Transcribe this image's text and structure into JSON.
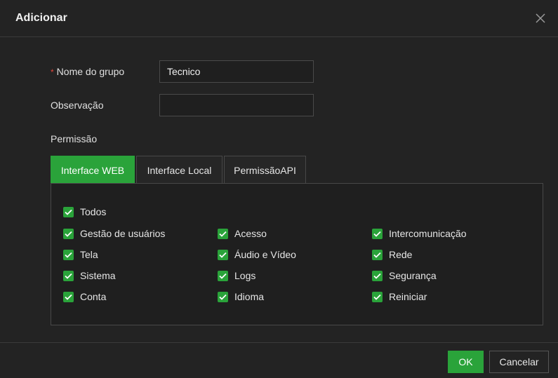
{
  "dialog": {
    "title": "Adicionar",
    "close_icon": "close-icon"
  },
  "form": {
    "group_name": {
      "label": "Nome do grupo",
      "required_mark": "*",
      "value": "Tecnico",
      "placeholder": ""
    },
    "observation": {
      "label": "Observação",
      "value": "",
      "placeholder": ""
    },
    "permission_label": "Permissão"
  },
  "tabs": [
    {
      "label": "Interface WEB",
      "active": true
    },
    {
      "label": "Interface Local",
      "active": false
    },
    {
      "label": "PermissãoAPI",
      "active": false
    }
  ],
  "permissions": {
    "all": {
      "label": "Todos",
      "checked": true
    },
    "items": [
      {
        "label": "Gestão de usuários",
        "checked": true
      },
      {
        "label": "Acesso",
        "checked": true
      },
      {
        "label": "Intercomunicação",
        "checked": true
      },
      {
        "label": "Tela",
        "checked": true
      },
      {
        "label": "Áudio e Vídeo",
        "checked": true
      },
      {
        "label": "Rede",
        "checked": true
      },
      {
        "label": "Sistema",
        "checked": true
      },
      {
        "label": "Logs",
        "checked": true
      },
      {
        "label": "Segurança",
        "checked": true
      },
      {
        "label": "Conta",
        "checked": true
      },
      {
        "label": "Idioma",
        "checked": true
      },
      {
        "label": "Reiniciar",
        "checked": true
      }
    ]
  },
  "footer": {
    "ok_label": "OK",
    "cancel_label": "Cancelar"
  },
  "colors": {
    "accent": "#2aa33a",
    "background": "#232323",
    "required": "#e0463c"
  }
}
